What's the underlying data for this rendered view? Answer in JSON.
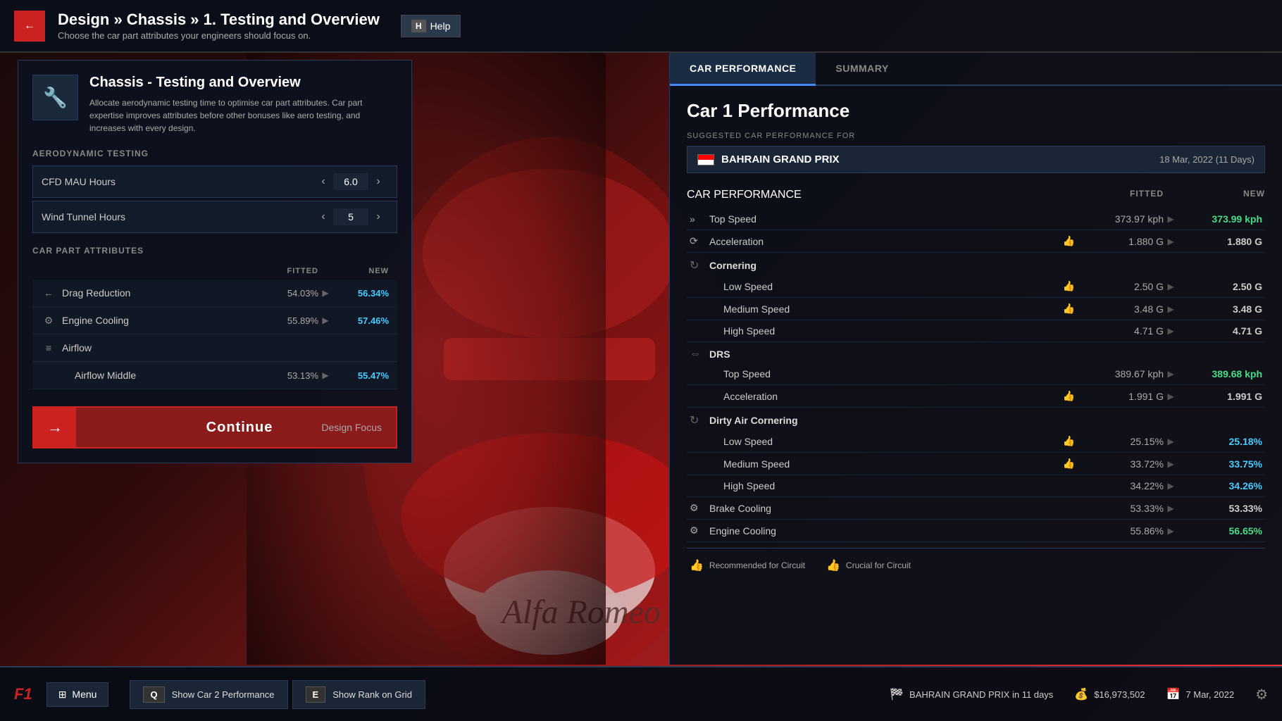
{
  "header": {
    "back_label": "←",
    "breadcrumb": "Design » Chassis » 1. Testing and Overview",
    "subtitle": "Choose the car part attributes your engineers should focus on.",
    "help_key": "H",
    "help_label": "Help"
  },
  "left_panel": {
    "icon": "🔧",
    "title": "Chassis - Testing and Overview",
    "description": "Allocate aerodynamic testing time to optimise car part attributes. Car part expertise improves attributes before other bonuses like aero testing, and increases with every design.",
    "aero_section": "AERODYNAMIC TESTING",
    "spinners": [
      {
        "label": "CFD MAU Hours",
        "value": "6.0"
      },
      {
        "label": "Wind Tunnel Hours",
        "value": "5"
      }
    ],
    "attributes_section": "CAR PART ATTRIBUTES",
    "attr_headers": {
      "fitted": "FITTED",
      "new": "NEW"
    },
    "attributes": [
      {
        "icon": "←",
        "name": "Drag Reduction",
        "fitted": "54.03%",
        "new": "56.34%",
        "sub": false
      },
      {
        "icon": "⚙",
        "name": "Engine Cooling",
        "fitted": "55.89%",
        "new": "57.46%",
        "sub": false
      },
      {
        "icon": "≡",
        "name": "Airflow",
        "fitted": "",
        "new": "",
        "sub": false
      },
      {
        "icon": "",
        "name": "Airflow Middle",
        "fitted": "53.13%",
        "new": "55.47%",
        "sub": true
      }
    ],
    "continue_label": "Continue",
    "design_focus_label": "Design Focus"
  },
  "right_panel": {
    "tab_car_performance": "CAR PERFORMANCE",
    "tab_summary": "SUMMARY",
    "car1_title": "Car 1 Performance",
    "suggested_label": "SUGGESTED CAR PERFORMANCE FOR",
    "grand_prix": {
      "name": "BAHRAIN GRAND PRIX",
      "date": "18 Mar, 2022 (11 Days)"
    },
    "perf_headers": {
      "fitted": "FITTED",
      "new": "NEW"
    },
    "performance": [
      {
        "section": "Top Speed",
        "icon": "»",
        "fitted": "373.97 kph",
        "new": "373.99 kph",
        "new_color": "green",
        "thumb": "none",
        "sub": false
      },
      {
        "section": "Acceleration",
        "icon": "⟳",
        "fitted": "1.880 G",
        "new": "1.880 G",
        "new_color": "white",
        "thumb": "blue",
        "sub": false
      },
      {
        "section": "Cornering",
        "icon": "↻",
        "fitted": "",
        "new": "",
        "new_color": "white",
        "thumb": "none",
        "sub": false,
        "is_header": true
      },
      {
        "section": "Low Speed",
        "icon": "",
        "fitted": "2.50 G",
        "new": "2.50 G",
        "new_color": "white",
        "thumb": "blue",
        "sub": true
      },
      {
        "section": "Medium Speed",
        "icon": "",
        "fitted": "3.48 G",
        "new": "3.48 G",
        "new_color": "white",
        "thumb": "green",
        "sub": true
      },
      {
        "section": "High Speed",
        "icon": "",
        "fitted": "4.71 G",
        "new": "4.71 G",
        "new_color": "white",
        "thumb": "none",
        "sub": true
      },
      {
        "section": "DRS",
        "icon": "⇔",
        "fitted": "",
        "new": "",
        "new_color": "white",
        "thumb": "none",
        "sub": false,
        "is_header": true
      },
      {
        "section": "Top Speed",
        "icon": "",
        "fitted": "389.67 kph",
        "new": "389.68 kph",
        "new_color": "green",
        "thumb": "none",
        "sub": true
      },
      {
        "section": "Acceleration",
        "icon": "",
        "fitted": "1.991 G",
        "new": "1.991 G",
        "new_color": "white",
        "thumb": "blue",
        "sub": true
      },
      {
        "section": "Dirty Air Cornering",
        "icon": "↻",
        "fitted": "",
        "new": "",
        "new_color": "white",
        "thumb": "none",
        "sub": false,
        "is_header": true
      },
      {
        "section": "Low Speed",
        "icon": "",
        "fitted": "25.15%",
        "new": "25.18%",
        "new_color": "teal",
        "thumb": "blue",
        "sub": true
      },
      {
        "section": "Medium Speed",
        "icon": "",
        "fitted": "33.72%",
        "new": "33.75%",
        "new_color": "teal",
        "thumb": "green",
        "sub": true
      },
      {
        "section": "High Speed",
        "icon": "",
        "fitted": "34.22%",
        "new": "34.26%",
        "new_color": "teal",
        "thumb": "none",
        "sub": true
      },
      {
        "section": "Brake Cooling",
        "icon": "⚙",
        "fitted": "53.33%",
        "new": "53.33%",
        "new_color": "white",
        "thumb": "none",
        "sub": false
      },
      {
        "section": "Engine Cooling",
        "icon": "⚙",
        "fitted": "55.86%",
        "new": "56.65%",
        "new_color": "green",
        "thumb": "none",
        "sub": false
      }
    ],
    "legend": [
      {
        "icon": "👍",
        "icon_color": "blue",
        "label": "Recommended for Circuit"
      },
      {
        "icon": "👍",
        "icon_color": "green",
        "label": "Crucial for Circuit"
      }
    ]
  },
  "bottom_bar": {
    "logo": "F1",
    "menu_label": "Menu",
    "shortcut1_key": "Q",
    "shortcut1_label": "Show Car 2 Performance",
    "shortcut2_key": "E",
    "shortcut2_label": "Show Rank on Grid",
    "gp_status": "BAHRAIN GRAND PRIX in 11 days",
    "money": "$16,973,502",
    "date": "7 Mar, 2022"
  }
}
